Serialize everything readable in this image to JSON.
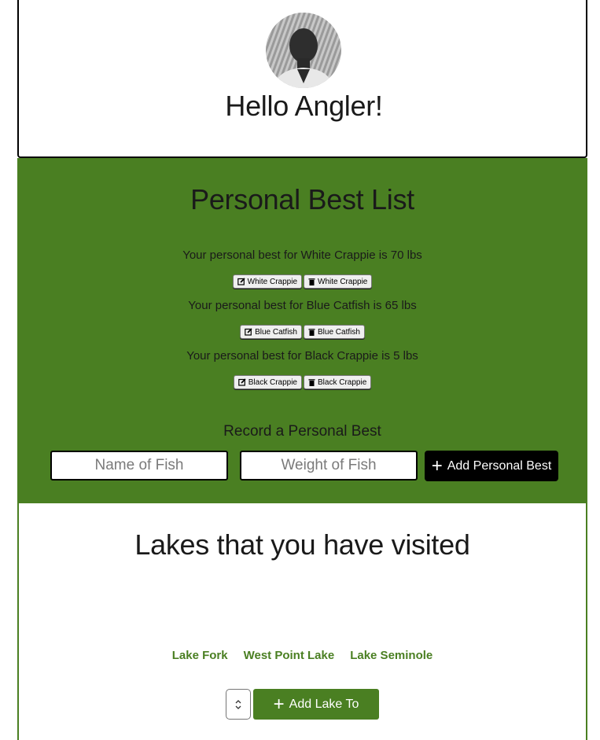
{
  "header": {
    "greeting": "Hello Angler!",
    "avatar_icon": "user-avatar-photo"
  },
  "personal_best": {
    "title": "Personal Best List",
    "entries": [
      {
        "text": "Your personal best for White Crappie is 70 lbs",
        "edit_label": "White Crappie",
        "delete_label": "White Crappie"
      },
      {
        "text": "Your personal best for Blue Catfish is 65 lbs",
        "edit_label": "Blue Catfish",
        "delete_label": "Blue Catfish"
      },
      {
        "text": "Your personal best for Black Crappie is 5 lbs",
        "edit_label": "Black Crappie",
        "delete_label": "Black Crappie"
      }
    ],
    "record_title": "Record a Personal Best",
    "name_placeholder": "Name of Fish",
    "weight_placeholder": "Weight of Fish",
    "add_button_label": "Add Personal Best"
  },
  "lakes": {
    "title": "Lakes that you have visited",
    "links": [
      "Lake Fork",
      "West Point Lake",
      "Lake Seminole"
    ],
    "add_button_label": "Add Lake To"
  },
  "colors": {
    "accent_green": "#4a7f22",
    "button_dark": "#000000"
  }
}
